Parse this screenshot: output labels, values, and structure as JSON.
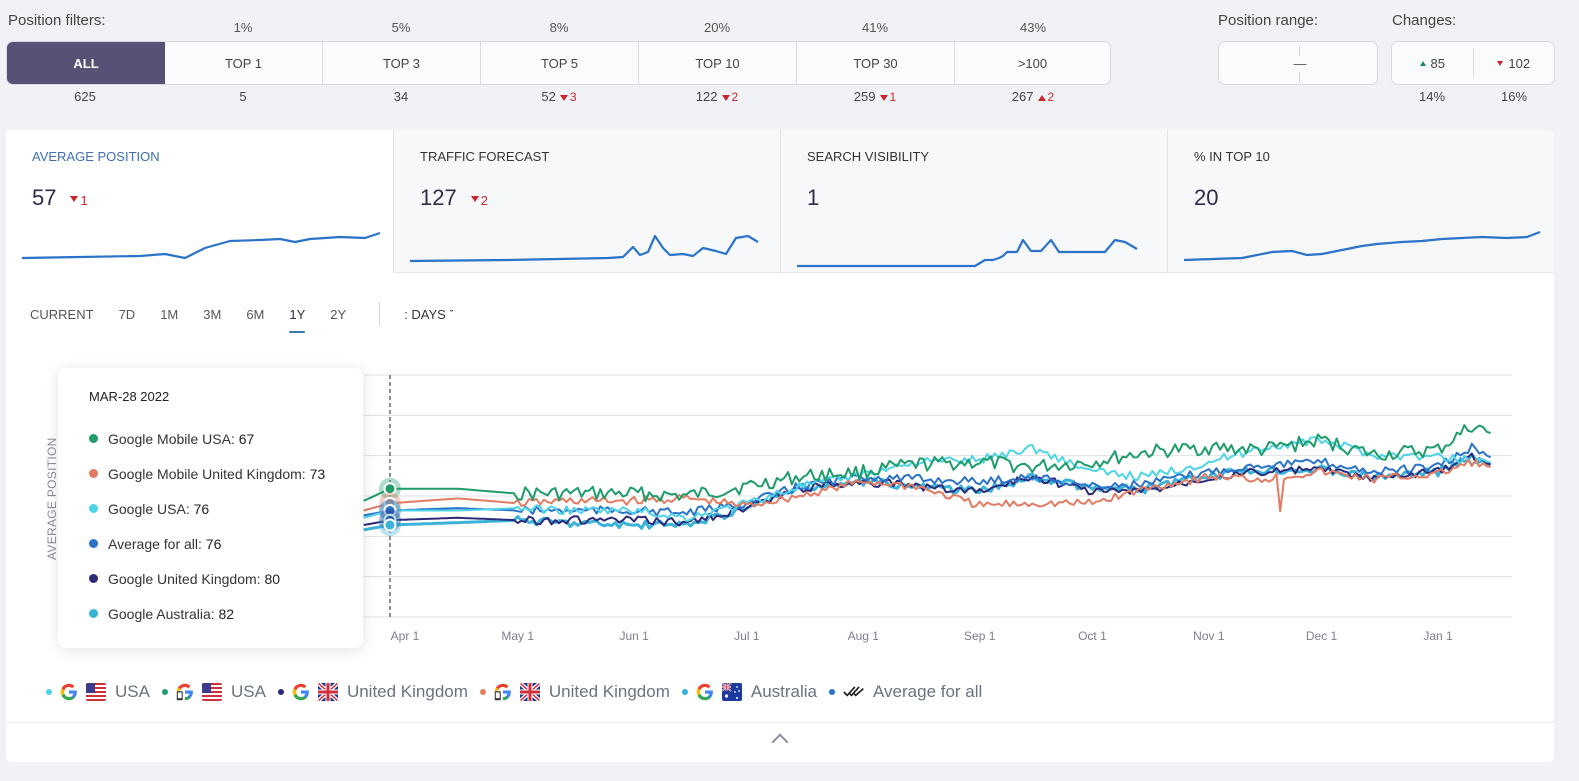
{
  "position_filters": {
    "label": "Position filters:",
    "items": [
      {
        "label": "ALL",
        "percent": "",
        "count": "625",
        "change": "",
        "direction": "",
        "active": true
      },
      {
        "label": "TOP 1",
        "percent": "1%",
        "count": "5",
        "change": "",
        "direction": ""
      },
      {
        "label": "TOP 3",
        "percent": "5%",
        "count": "34",
        "change": "",
        "direction": ""
      },
      {
        "label": "TOP 5",
        "percent": "8%",
        "count": "52",
        "change": "3",
        "direction": "down"
      },
      {
        "label": "TOP 10",
        "percent": "20%",
        "count": "122",
        "change": "2",
        "direction": "down"
      },
      {
        "label": "TOP 30",
        "percent": "41%",
        "count": "259",
        "change": "1",
        "direction": "down"
      },
      {
        "label": ">100",
        "percent": "43%",
        "count": "267",
        "change": "2",
        "direction": "up"
      }
    ]
  },
  "position_range": {
    "label": "Position range:",
    "separator": "—"
  },
  "changes": {
    "label": "Changes:",
    "up": {
      "value": "85",
      "percent": "14%"
    },
    "down": {
      "value": "102",
      "percent": "16%"
    }
  },
  "metrics": [
    {
      "title": "AVERAGE POSITION",
      "value": "57",
      "change": "1",
      "active": true,
      "spark": [
        10,
        10,
        10,
        11,
        11,
        11,
        12,
        12,
        11,
        8,
        20,
        26,
        26,
        28,
        24,
        28,
        30,
        31,
        24,
        27,
        28,
        31,
        33,
        33,
        35,
        35,
        30,
        32,
        33,
        33,
        38
      ]
    },
    {
      "title": "TRAFFIC FORECAST",
      "value": "127",
      "change": "2"
    },
    {
      "title": "SEARCH VISIBILITY",
      "value": "1"
    },
    {
      "title": "% IN TOP 10",
      "value": "20"
    }
  ],
  "periods": [
    "CURRENT",
    "7D",
    "1M",
    "3M",
    "6M",
    "1Y",
    "2Y"
  ],
  "active_period": "1Y",
  "granularity": ": DAYS",
  "tooltip": {
    "date": "MAR-28 2022",
    "rows": [
      {
        "name": "Google Mobile USA:",
        "value": "67",
        "color": "#1e9c6a"
      },
      {
        "name": "Google Mobile United Kingdom:",
        "value": "73",
        "color": "#e37b63"
      },
      {
        "name": "Google USA:",
        "value": "76",
        "color": "#4fd3e8"
      },
      {
        "name": "Average for all:",
        "value": "76",
        "color": "#2a73c8"
      },
      {
        "name": "Google United Kingdom:",
        "value": "80",
        "color": "#2b2a7a"
      },
      {
        "name": "Google Australia:",
        "value": "82",
        "color": "#3ab3d8"
      }
    ]
  },
  "legend": [
    {
      "label": "USA",
      "engine": "google",
      "flag": "us",
      "color": "#4fd3e8"
    },
    {
      "label": "USA",
      "engine": "google-mobile",
      "flag": "us",
      "color": "#1e9c6a"
    },
    {
      "label": "United Kingdom",
      "engine": "google",
      "flag": "uk",
      "color": "#2b2a7a"
    },
    {
      "label": "United Kingdom",
      "engine": "google-mobile",
      "flag": "uk",
      "color": "#e37b63"
    },
    {
      "label": "Australia",
      "engine": "google",
      "flag": "au",
      "color": "#3ab3d8"
    },
    {
      "label": "Average for all",
      "engine": "average",
      "flag": "",
      "color": "#2a73c8"
    }
  ],
  "chart_data": {
    "type": "line",
    "title": "",
    "xlabel": "",
    "ylabel": "AVERAGE POSITION",
    "x_ticks": [
      "Apr 1",
      "May 1",
      "Jun 1",
      "Jul 1",
      "Aug 1",
      "Sep 1",
      "Oct 1",
      "Nov 1",
      "Dec 1",
      "Jan 1"
    ],
    "x": [
      "Mar 21",
      "Mar 28",
      "Apr 15",
      "May 1",
      "May 15",
      "Jun 1",
      "Jun 15",
      "Jul 1",
      "Jul 15",
      "Aug 1",
      "Aug 15",
      "Sep 1",
      "Sep 15",
      "Oct 1",
      "Oct 15",
      "Nov 1",
      "Nov 15",
      "Dec 1",
      "Dec 15",
      "Jan 1",
      "Jan 10",
      "Jan 15"
    ],
    "y_reversed": true,
    "ylim": [
      20,
      120
    ],
    "grid": true,
    "highlight_x": "Mar 28",
    "series": [
      {
        "name": "Google Mobile USA",
        "color": "#1e9c6a",
        "values": [
          72,
          67,
          67,
          69,
          69,
          69,
          70,
          66,
          62,
          60,
          57,
          56,
          58,
          56,
          52,
          50,
          51,
          47,
          53,
          51,
          41,
          44
        ]
      },
      {
        "name": "Google Mobile United Kingdom",
        "color": "#e37b63",
        "values": [
          76,
          73,
          71,
          73,
          72,
          72,
          71,
          74,
          70,
          64,
          66,
          74,
          73,
          73,
          67,
          62,
          63,
          60,
          63,
          61,
          56,
          58
        ]
      },
      {
        "name": "Google USA",
        "color": "#4fd3e8",
        "values": [
          79,
          76,
          76,
          75,
          76,
          76,
          79,
          73,
          66,
          61,
          56,
          55,
          50,
          60,
          62,
          56,
          50,
          47,
          53,
          54,
          55,
          56
        ]
      },
      {
        "name": "Average for all",
        "color": "#2a73c8",
        "values": [
          78,
          76,
          75,
          76,
          76,
          76,
          77,
          73,
          66,
          62,
          63,
          64,
          62,
          66,
          65,
          60,
          57,
          56,
          60,
          58,
          50,
          54
        ]
      },
      {
        "name": "Google United Kingdom",
        "color": "#2b2a7a",
        "values": [
          82,
          80,
          79,
          80,
          80,
          80,
          81,
          75,
          67,
          64,
          66,
          68,
          62,
          68,
          68,
          62,
          60,
          59,
          63,
          60,
          54,
          57
        ]
      },
      {
        "name": "Google Australia",
        "color": "#3ab3d8",
        "values": [
          84,
          82,
          81,
          80,
          81,
          82,
          82,
          75,
          67,
          64,
          66,
          68,
          62,
          67,
          67,
          62,
          59,
          59,
          62,
          60,
          54,
          57
        ]
      }
    ]
  },
  "collapse": {
    "icon": "chevron-up-icon"
  }
}
